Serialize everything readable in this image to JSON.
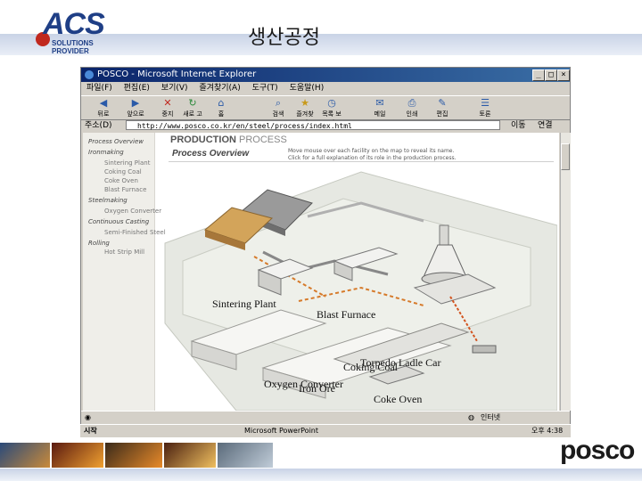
{
  "header": {
    "logo_text": "ACS",
    "logo_tagline": "SOLUTIONS PROVIDER",
    "slide_title": "생산공정"
  },
  "browser": {
    "window_title": "POSCO - Microsoft Internet Explorer",
    "menu": [
      "파일(F)",
      "편집(E)",
      "보기(V)",
      "즐겨찾기(A)",
      "도구(T)",
      "도움말(H)"
    ],
    "toolbar": [
      "뒤로",
      "앞으로",
      "중지",
      "새로 고침",
      "홈",
      "검색",
      "즐겨찾기",
      "목록 보기",
      "메일",
      "인쇄",
      "편집",
      "토론"
    ],
    "address_label": "주소(D)",
    "address_value": "http://www.posco.co.kr/en/steel/process/index.html",
    "go_label": "이동",
    "links_label": "연결"
  },
  "page": {
    "section_title_bold": "PRODUCTION",
    "section_title_light": "PROCESS",
    "subtitle": "Process Overview",
    "hint_line1": "Move mouse over each facility on the map to reveal its name.",
    "hint_line2": "Click for a full explanation of its role in the production process.",
    "nav": [
      {
        "text": "Process Overview",
        "kind": "h"
      },
      {
        "text": "Ironmaking",
        "kind": "h"
      },
      {
        "text": "Sintering Plant",
        "kind": "sub"
      },
      {
        "text": "Coking Coal",
        "kind": "sub"
      },
      {
        "text": "Coke Oven",
        "kind": "sub"
      },
      {
        "text": "Blast Furnace",
        "kind": "sub"
      },
      {
        "text": "Steelmaking",
        "kind": "h"
      },
      {
        "text": "Oxygen Converter",
        "kind": "sub"
      },
      {
        "text": "Continuous Casting",
        "kind": "h"
      },
      {
        "text": "Semi-Finished Steel",
        "kind": "sub"
      },
      {
        "text": "Rolling",
        "kind": "h"
      },
      {
        "text": "Hot Strip Mill",
        "kind": "sub"
      }
    ],
    "labels": {
      "coking_coal": "Coking Coal",
      "iron_ore": "Iron Ore",
      "coke_oven": "Coke Oven",
      "sintering_plant": "Sintering Plant",
      "blast_furnace": "Blast Furnace",
      "torpedo": "Torpedo Ladle Car",
      "oxygen_converter": "Oxygen Converter"
    }
  },
  "status": {
    "zone": "인터넷"
  },
  "taskbar": {
    "start": "시작",
    "task": "Microsoft PowerPoint",
    "clock": "오후 4:38"
  },
  "footer": {
    "brand": "posco"
  },
  "colors": {
    "accent": "#1f3f86",
    "titlebar": "#0a246a",
    "brand": "#1b1b1b"
  }
}
